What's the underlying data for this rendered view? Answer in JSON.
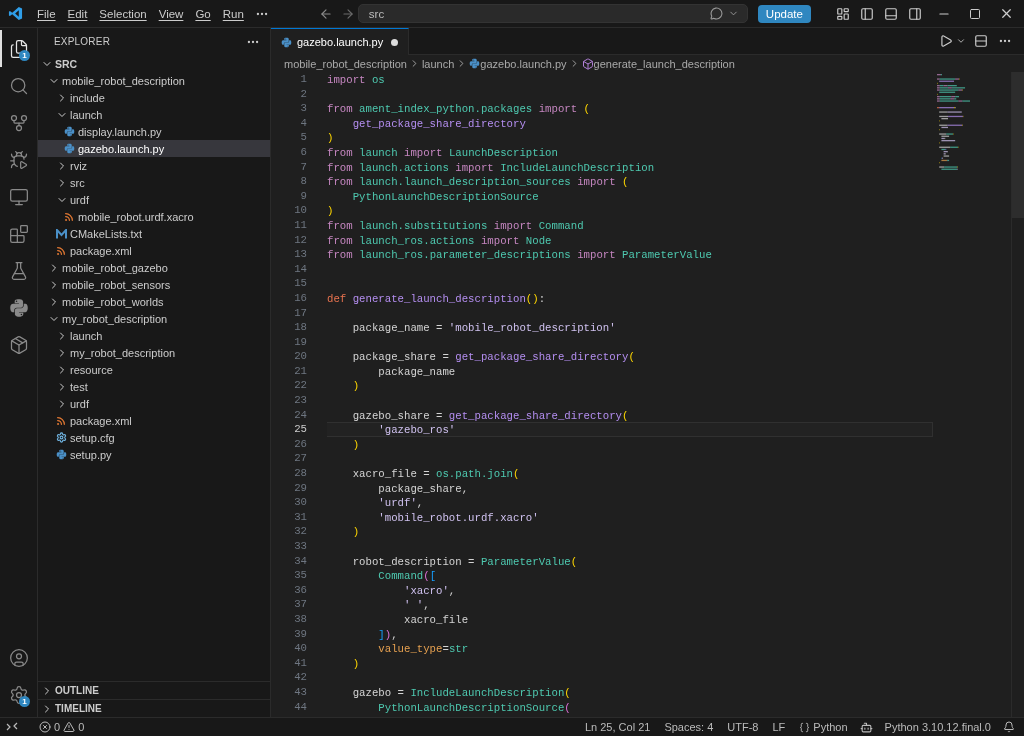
{
  "title_bar": {
    "menus": [
      {
        "label": "File"
      },
      {
        "label": "Edit"
      },
      {
        "label": "Selection"
      },
      {
        "label": "View"
      },
      {
        "label": "Go"
      },
      {
        "label": "Run"
      }
    ],
    "search": {
      "value": "src"
    },
    "update_button": "Update"
  },
  "activity_bar": {
    "items": [
      {
        "kind": "explorer",
        "selected": true,
        "badge": "1"
      },
      {
        "kind": "search",
        "selected": false
      },
      {
        "kind": "source-control",
        "selected": false
      },
      {
        "kind": "run-debug",
        "selected": false
      },
      {
        "kind": "remote",
        "selected": false
      },
      {
        "kind": "extensions",
        "selected": false
      },
      {
        "kind": "testing",
        "selected": false
      },
      {
        "kind": "python",
        "selected": false
      },
      {
        "kind": "package",
        "selected": false
      }
    ],
    "bottom": [
      {
        "kind": "account"
      },
      {
        "kind": "settings",
        "badge": "1"
      }
    ]
  },
  "sidebar": {
    "title": "EXPLORER",
    "root": {
      "label": "SRC",
      "expanded": true
    },
    "tree": [
      {
        "label": "mobile_robot_description",
        "kind": "folder",
        "expanded": true,
        "selected": false,
        "children": [
          {
            "label": "include",
            "kind": "folder",
            "expanded": false,
            "selected": false
          },
          {
            "label": "launch",
            "kind": "folder",
            "expanded": true,
            "selected": false,
            "children": [
              {
                "label": "display.launch.py",
                "kind": "python",
                "selected": false
              },
              {
                "label": "gazebo.launch.py",
                "kind": "python",
                "selected": true
              }
            ]
          },
          {
            "label": "rviz",
            "kind": "folder",
            "expanded": false,
            "selected": false
          },
          {
            "label": "src",
            "kind": "folder",
            "expanded": false,
            "selected": false
          },
          {
            "label": "urdf",
            "kind": "folder",
            "expanded": true,
            "selected": false,
            "children": [
              {
                "label": "mobile_robot.urdf.xacro",
                "kind": "xml",
                "selected": false
              }
            ]
          },
          {
            "label": "CMakeLists.txt",
            "kind": "cmake",
            "selected": false
          },
          {
            "label": "package.xml",
            "kind": "xml",
            "selected": false
          }
        ]
      },
      {
        "label": "mobile_robot_gazebo",
        "kind": "folder",
        "expanded": false,
        "selected": false
      },
      {
        "label": "mobile_robot_sensors",
        "kind": "folder",
        "expanded": false,
        "selected": false
      },
      {
        "label": "mobile_robot_worlds",
        "kind": "folder",
        "expanded": false,
        "selected": false
      },
      {
        "label": "my_robot_description",
        "kind": "folder",
        "expanded": true,
        "selected": false,
        "children": [
          {
            "label": "launch",
            "kind": "folder",
            "expanded": false,
            "selected": false
          },
          {
            "label": "my_robot_description",
            "kind": "folder",
            "expanded": false,
            "selected": false
          },
          {
            "label": "resource",
            "kind": "folder",
            "expanded": false,
            "selected": false
          },
          {
            "label": "test",
            "kind": "folder",
            "expanded": false,
            "selected": false
          },
          {
            "label": "urdf",
            "kind": "folder",
            "expanded": false,
            "selected": false
          },
          {
            "label": "package.xml",
            "kind": "xml",
            "selected": false
          },
          {
            "label": "setup.cfg",
            "kind": "config",
            "selected": false
          },
          {
            "label": "setup.py",
            "kind": "python",
            "selected": false
          }
        ]
      }
    ],
    "sections": [
      {
        "label": "OUTLINE",
        "expanded": false
      },
      {
        "label": "TIMELINE",
        "expanded": false
      }
    ]
  },
  "editor": {
    "tabs": [
      {
        "label": "gazebo.launch.py",
        "selected": true,
        "modified": true
      }
    ],
    "breadcrumbs": [
      {
        "label": "mobile_robot_description",
        "kind": "folder"
      },
      {
        "label": "launch",
        "kind": "folder"
      },
      {
        "label": "gazebo.launch.py",
        "kind": "python"
      },
      {
        "label": "generate_launch_description",
        "kind": "function"
      }
    ],
    "lines": [
      {
        "number": "1",
        "active": false,
        "tokens": [
          {
            "kind": "keyword",
            "text": "import "
          },
          {
            "kind": "module",
            "text": "os"
          }
        ]
      },
      {
        "number": "2",
        "active": false
      },
      {
        "number": "3",
        "active": false,
        "tokens": [
          {
            "kind": "keyword",
            "text": "from "
          },
          {
            "kind": "module",
            "text": "ament_index_python.packages "
          },
          {
            "kind": "keyword",
            "text": "import "
          },
          {
            "kind": "bracket1",
            "text": "("
          }
        ]
      },
      {
        "number": "4",
        "active": false,
        "tokens": [
          {
            "kind": "function",
            "text": "    get_package_share_directory"
          }
        ]
      },
      {
        "number": "5",
        "active": false,
        "tokens": [
          {
            "kind": "bracket1",
            "text": ")"
          }
        ]
      },
      {
        "number": "6",
        "active": false,
        "tokens": [
          {
            "kind": "keyword",
            "text": "from "
          },
          {
            "kind": "module",
            "text": "launch "
          },
          {
            "kind": "keyword",
            "text": "import "
          },
          {
            "kind": "class",
            "text": "LaunchDescription"
          }
        ]
      },
      {
        "number": "7",
        "active": false,
        "tokens": [
          {
            "kind": "keyword",
            "text": "from "
          },
          {
            "kind": "module",
            "text": "launch.actions "
          },
          {
            "kind": "keyword",
            "text": "import "
          },
          {
            "kind": "class",
            "text": "IncludeLaunchDescription"
          }
        ]
      },
      {
        "number": "8",
        "active": false,
        "tokens": [
          {
            "kind": "keyword",
            "text": "from "
          },
          {
            "kind": "module",
            "text": "launch.launch_description_sources "
          },
          {
            "kind": "keyword",
            "text": "import "
          },
          {
            "kind": "bracket1",
            "text": "("
          }
        ]
      },
      {
        "number": "9",
        "active": false,
        "tokens": [
          {
            "kind": "class",
            "text": "    PythonLaunchDescriptionSource"
          }
        ]
      },
      {
        "number": "10",
        "active": false,
        "tokens": [
          {
            "kind": "bracket1",
            "text": ")"
          }
        ]
      },
      {
        "number": "11",
        "active": false,
        "tokens": [
          {
            "kind": "keyword",
            "text": "from "
          },
          {
            "kind": "module",
            "text": "launch.substitutions "
          },
          {
            "kind": "keyword",
            "text": "import "
          },
          {
            "kind": "class",
            "text": "Command"
          }
        ]
      },
      {
        "number": "12",
        "active": false,
        "tokens": [
          {
            "kind": "keyword",
            "text": "from "
          },
          {
            "kind": "module",
            "text": "launch_ros.actions "
          },
          {
            "kind": "keyword",
            "text": "import "
          },
          {
            "kind": "class",
            "text": "Node"
          }
        ]
      },
      {
        "number": "13",
        "active": false,
        "tokens": [
          {
            "kind": "keyword",
            "text": "from "
          },
          {
            "kind": "module",
            "text": "launch_ros.parameter_descriptions "
          },
          {
            "kind": "keyword",
            "text": "import "
          },
          {
            "kind": "class",
            "text": "ParameterValue"
          }
        ]
      },
      {
        "number": "14",
        "active": false
      },
      {
        "number": "15",
        "active": false
      },
      {
        "number": "16",
        "active": false,
        "tokens": [
          {
            "kind": "def",
            "text": "def "
          },
          {
            "kind": "function",
            "text": "generate_launch_description"
          },
          {
            "kind": "bracket1",
            "text": "()"
          },
          {
            "kind": "plain",
            "text": ":"
          }
        ]
      },
      {
        "number": "17",
        "active": false
      },
      {
        "number": "18",
        "active": false,
        "tokens": [
          {
            "kind": "plain",
            "text": "    package_name = "
          },
          {
            "kind": "string",
            "text": "'mobile_robot_description'"
          }
        ]
      },
      {
        "number": "19",
        "active": false
      },
      {
        "number": "20",
        "active": false,
        "tokens": [
          {
            "kind": "plain",
            "text": "    package_share = "
          },
          {
            "kind": "function",
            "text": "get_package_share_directory"
          },
          {
            "kind": "bracket1",
            "text": "("
          }
        ]
      },
      {
        "number": "21",
        "active": false,
        "tokens": [
          {
            "kind": "plain",
            "text": "        package_name"
          }
        ]
      },
      {
        "number": "22",
        "active": false,
        "tokens": [
          {
            "kind": "bracket1",
            "text": "    )"
          }
        ]
      },
      {
        "number": "23",
        "active": false
      },
      {
        "number": "24",
        "active": false,
        "tokens": [
          {
            "kind": "plain",
            "text": "    gazebo_share = "
          },
          {
            "kind": "function",
            "text": "get_package_share_directory"
          },
          {
            "kind": "bracket1",
            "text": "("
          }
        ]
      },
      {
        "number": "25",
        "active": true,
        "tokens": [
          {
            "kind": "string",
            "text": "        'gazebo_ros'"
          }
        ]
      },
      {
        "number": "26",
        "active": false,
        "tokens": [
          {
            "kind": "bracket1",
            "text": "    )"
          }
        ]
      },
      {
        "number": "27",
        "active": false
      },
      {
        "number": "28",
        "active": false,
        "tokens": [
          {
            "kind": "plain",
            "text": "    xacro_file = "
          },
          {
            "kind": "class",
            "text": "os.path.join"
          },
          {
            "kind": "bracket1",
            "text": "("
          }
        ]
      },
      {
        "number": "29",
        "active": false,
        "tokens": [
          {
            "kind": "plain",
            "text": "        package_share,"
          }
        ]
      },
      {
        "number": "30",
        "active": false,
        "tokens": [
          {
            "kind": "string",
            "text": "        'urdf'"
          },
          {
            "kind": "plain",
            "text": ","
          }
        ]
      },
      {
        "number": "31",
        "active": false,
        "tokens": [
          {
            "kind": "string",
            "text": "        'mobile_robot.urdf.xacro'"
          }
        ]
      },
      {
        "number": "32",
        "active": false,
        "tokens": [
          {
            "kind": "bracket1",
            "text": "    )"
          }
        ]
      },
      {
        "number": "33",
        "active": false
      },
      {
        "number": "34",
        "active": false,
        "tokens": [
          {
            "kind": "plain",
            "text": "    robot_description = "
          },
          {
            "kind": "class",
            "text": "ParameterValue"
          },
          {
            "kind": "bracket1",
            "text": "("
          }
        ]
      },
      {
        "number": "35",
        "active": false,
        "tokens": [
          {
            "kind": "class",
            "text": "        Command"
          },
          {
            "kind": "bracket2",
            "text": "("
          },
          {
            "kind": "bracket3",
            "text": "["
          }
        ]
      },
      {
        "number": "36",
        "active": false,
        "tokens": [
          {
            "kind": "string",
            "text": "            'xacro'"
          },
          {
            "kind": "plain",
            "text": ","
          }
        ]
      },
      {
        "number": "37",
        "active": false,
        "tokens": [
          {
            "kind": "string",
            "text": "            ' '"
          },
          {
            "kind": "plain",
            "text": ","
          }
        ]
      },
      {
        "number": "38",
        "active": false,
        "tokens": [
          {
            "kind": "plain",
            "text": "            xacro_file"
          }
        ]
      },
      {
        "number": "39",
        "active": false,
        "tokens": [
          {
            "kind": "bracket3",
            "text": "        ]"
          },
          {
            "kind": "bracket2",
            "text": ")"
          },
          {
            "kind": "plain",
            "text": ","
          }
        ]
      },
      {
        "number": "40",
        "active": false,
        "tokens": [
          {
            "kind": "parameter",
            "text": "        value_type"
          },
          {
            "kind": "plain",
            "text": "="
          },
          {
            "kind": "class",
            "text": "str"
          }
        ]
      },
      {
        "number": "41",
        "active": false,
        "tokens": [
          {
            "kind": "bracket1",
            "text": "    )"
          }
        ]
      },
      {
        "number": "42",
        "active": false
      },
      {
        "number": "43",
        "active": false,
        "tokens": [
          {
            "kind": "plain",
            "text": "    gazebo = "
          },
          {
            "kind": "class",
            "text": "IncludeLaunchDescription"
          },
          {
            "kind": "bracket1",
            "text": "("
          }
        ]
      },
      {
        "number": "44",
        "active": false,
        "tokens": [
          {
            "kind": "class",
            "text": "        PythonLaunchDescriptionSource"
          },
          {
            "kind": "bracket2",
            "text": "("
          }
        ]
      }
    ]
  },
  "status_bar": {
    "errors": "0",
    "warnings": "0",
    "items": [
      {
        "kind": "text",
        "label": "Ln 25, Col 21"
      },
      {
        "kind": "text",
        "label": "Spaces: 4"
      },
      {
        "kind": "text",
        "label": "UTF-8"
      },
      {
        "kind": "text",
        "label": "LF"
      },
      {
        "kind": "language",
        "label": "Python"
      },
      {
        "kind": "interpreter",
        "label": "Python 3.10.12.final.0"
      }
    ]
  }
}
